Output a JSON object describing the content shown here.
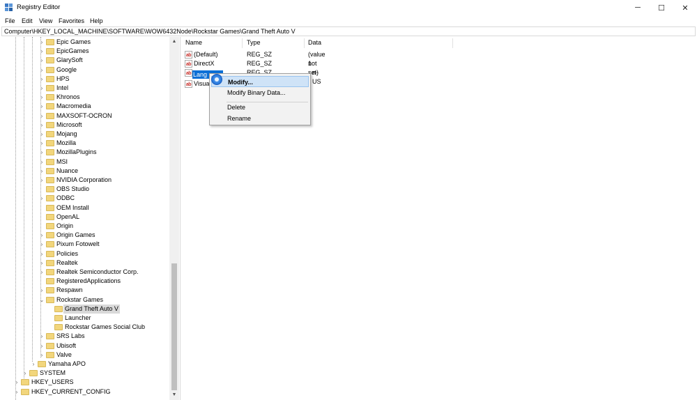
{
  "window": {
    "title": "Registry Editor",
    "icon": "registry-editor-icon",
    "controls": [
      "minimize",
      "maximize",
      "close"
    ]
  },
  "menu": [
    "File",
    "Edit",
    "View",
    "Favorites",
    "Help"
  ],
  "address": "Computer\\HKEY_LOCAL_MACHINE\\SOFTWARE\\WOW6432Node\\Rockstar Games\\Grand Theft Auto V",
  "tree": {
    "items": [
      {
        "label": "Epic Games",
        "level": 3,
        "expandable": true
      },
      {
        "label": "EpicGames",
        "level": 3,
        "expandable": true
      },
      {
        "label": "GlarySoft",
        "level": 3,
        "expandable": true
      },
      {
        "label": "Google",
        "level": 3,
        "expandable": true
      },
      {
        "label": "HPS",
        "level": 3,
        "expandable": true
      },
      {
        "label": "Intel",
        "level": 3,
        "expandable": true
      },
      {
        "label": "Khronos",
        "level": 3,
        "expandable": true
      },
      {
        "label": "Macromedia",
        "level": 3,
        "expandable": true
      },
      {
        "label": "MAXSOFT-OCRON",
        "level": 3,
        "expandable": true
      },
      {
        "label": "Microsoft",
        "level": 3,
        "expandable": true
      },
      {
        "label": "Mojang",
        "level": 3,
        "expandable": true
      },
      {
        "label": "Mozilla",
        "level": 3,
        "expandable": true
      },
      {
        "label": "MozillaPlugins",
        "level": 3,
        "expandable": true
      },
      {
        "label": "MSI",
        "level": 3,
        "expandable": true
      },
      {
        "label": "Nuance",
        "level": 3,
        "expandable": true
      },
      {
        "label": "NVIDIA Corporation",
        "level": 3,
        "expandable": true
      },
      {
        "label": "OBS Studio",
        "level": 3,
        "expandable": false
      },
      {
        "label": "ODBC",
        "level": 3,
        "expandable": true
      },
      {
        "label": "OEM Install",
        "level": 3,
        "expandable": false
      },
      {
        "label": "OpenAL",
        "level": 3,
        "expandable": false
      },
      {
        "label": "Origin",
        "level": 3,
        "expandable": false
      },
      {
        "label": "Origin Games",
        "level": 3,
        "expandable": true
      },
      {
        "label": "Pixum Fotowelt",
        "level": 3,
        "expandable": true
      },
      {
        "label": "Policies",
        "level": 3,
        "expandable": true
      },
      {
        "label": "Realtek",
        "level": 3,
        "expandable": true
      },
      {
        "label": "Realtek Semiconductor Corp.",
        "level": 3,
        "expandable": true
      },
      {
        "label": "RegisteredApplications",
        "level": 3,
        "expandable": false
      },
      {
        "label": "Respawn",
        "level": 3,
        "expandable": true
      },
      {
        "label": "Rockstar Games",
        "level": 3,
        "expandable": true,
        "expanded": true
      },
      {
        "label": "Grand Theft Auto V",
        "level": 4,
        "expandable": false,
        "selected": true
      },
      {
        "label": "Launcher",
        "level": 4,
        "expandable": false
      },
      {
        "label": "Rockstar Games Social Club",
        "level": 4,
        "expandable": false
      },
      {
        "label": "SRS Labs",
        "level": 3,
        "expandable": true
      },
      {
        "label": "Ubisoft",
        "level": 3,
        "expandable": true
      },
      {
        "label": "Valve",
        "level": 3,
        "expandable": true
      },
      {
        "label": "Yamaha APO",
        "level": 2,
        "expandable": true
      },
      {
        "label": "SYSTEM",
        "level": 1,
        "expandable": true
      },
      {
        "label": "HKEY_USERS",
        "level": 0,
        "expandable": true
      },
      {
        "label": "HKEY_CURRENT_CONFIG",
        "level": 0,
        "expandable": true
      }
    ]
  },
  "values": {
    "columns": [
      "Name",
      "Type",
      "Data"
    ],
    "rows": [
      {
        "name": "(Default)",
        "type": "REG_SZ",
        "data": "(value not set)"
      },
      {
        "name": "DirectX",
        "type": "REG_SZ",
        "data": "1"
      },
      {
        "name": "Lang",
        "type": "REG_SZ",
        "data": "n-US"
      },
      {
        "name": "Visua",
        "type": "",
        "data": ""
      }
    ],
    "selected_row": 2
  },
  "context_menu": {
    "items": [
      "Modify...",
      "Modify Binary Data...",
      "Delete",
      "Rename"
    ],
    "highlighted": 0
  },
  "colors": {
    "selection": "#0b6fd6",
    "menu_highlight": "#cfe3f7",
    "folder": "#f2d67c"
  }
}
